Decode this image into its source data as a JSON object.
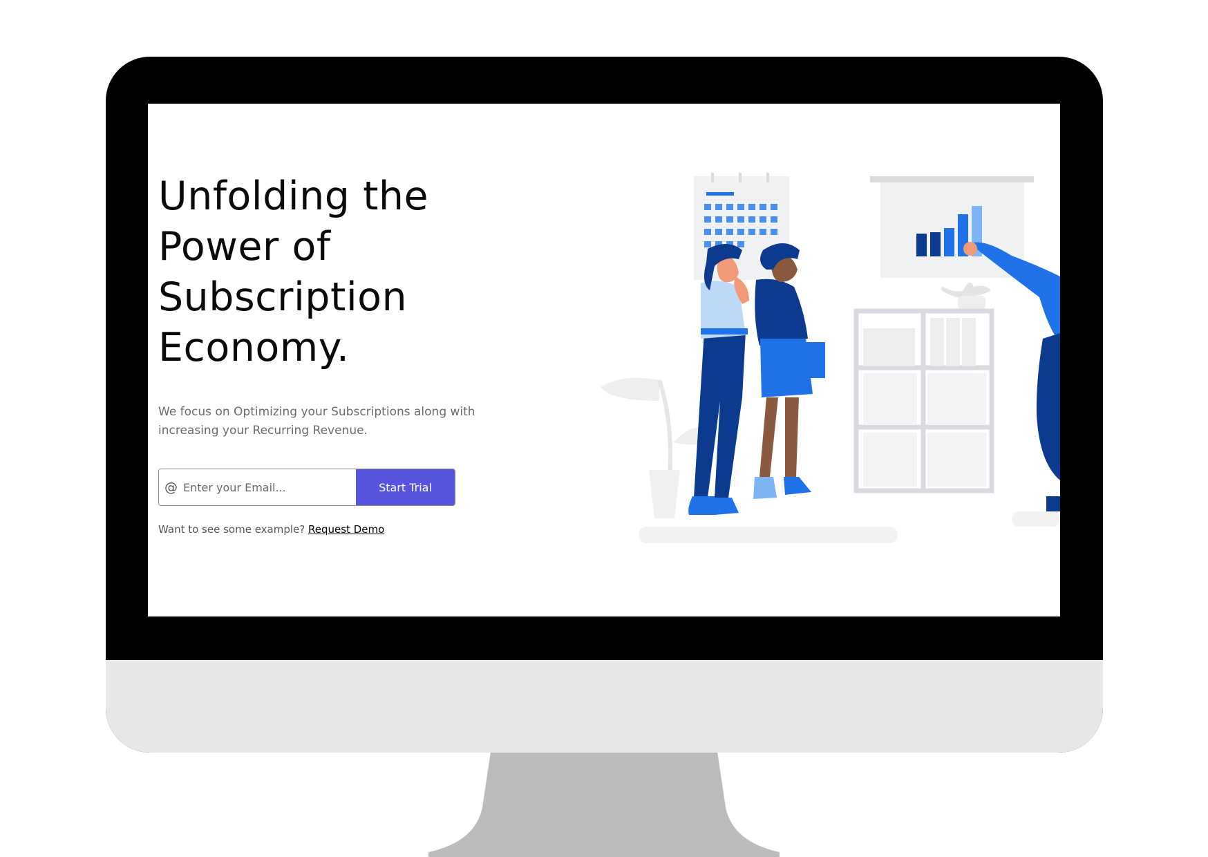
{
  "hero": {
    "title_line1": "Unfolding the",
    "title_line2": "Power of",
    "title_line3": "Subscription",
    "title_line4": "Economy.",
    "subtitle_line1": "We focus on Optimizing your Subscriptions along with",
    "subtitle_line2": "increasing your Recurring Revenue."
  },
  "signup": {
    "at_symbol": "@",
    "email_placeholder": "Enter your Email...",
    "start_trial_label": "Start Trial"
  },
  "demo": {
    "prompt": "Want to see some example?",
    "link_label": "Request Demo"
  },
  "colors": {
    "accent": "#5755dd",
    "illustration_dark_blue": "#0b3a8f",
    "illustration_mid_blue": "#1f72e8",
    "illustration_light_blue": "#bcd9f7",
    "monitor_bezel": "#000000",
    "monitor_chin": "#e8e8e8",
    "monitor_stand": "#bcbcbc"
  },
  "icons": {
    "email": "at-sign-icon"
  }
}
